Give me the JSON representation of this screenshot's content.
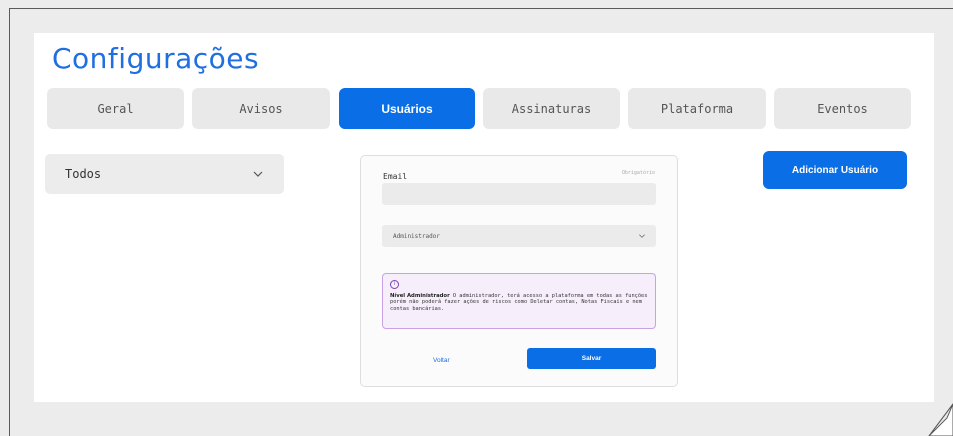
{
  "page": {
    "title": "Configurações"
  },
  "tabs": [
    {
      "label": "Geral",
      "active": false
    },
    {
      "label": "Avisos",
      "active": false
    },
    {
      "label": "Usuários",
      "active": true
    },
    {
      "label": "Assinaturas",
      "active": false
    },
    {
      "label": "Plataforma",
      "active": false
    },
    {
      "label": "Eventos",
      "active": false
    }
  ],
  "filter": {
    "selected": "Todos",
    "icon": "chevron-down-icon"
  },
  "actions": {
    "add_user_label": "Adicionar Usuário"
  },
  "form": {
    "email_label": "Email",
    "required_text": "Obrigatório",
    "email_value": "",
    "role_selected": "Administrador",
    "info": {
      "icon": "info-icon",
      "title": "Nível Administrador",
      "text": " O administrador, terá acesso a plataforma em todas as funções porém não poderá fazer ações de riscos como Deletar contas, Notas Fiscais e nem contas bancárias."
    },
    "back_label": "Voltar",
    "save_label": "Salvar"
  },
  "colors": {
    "accent": "#0a6fe6",
    "title": "#1f6fe0",
    "tab_bg": "#e9e9e9",
    "info_bg": "#f6eefb",
    "info_border": "#c9a2e6"
  }
}
